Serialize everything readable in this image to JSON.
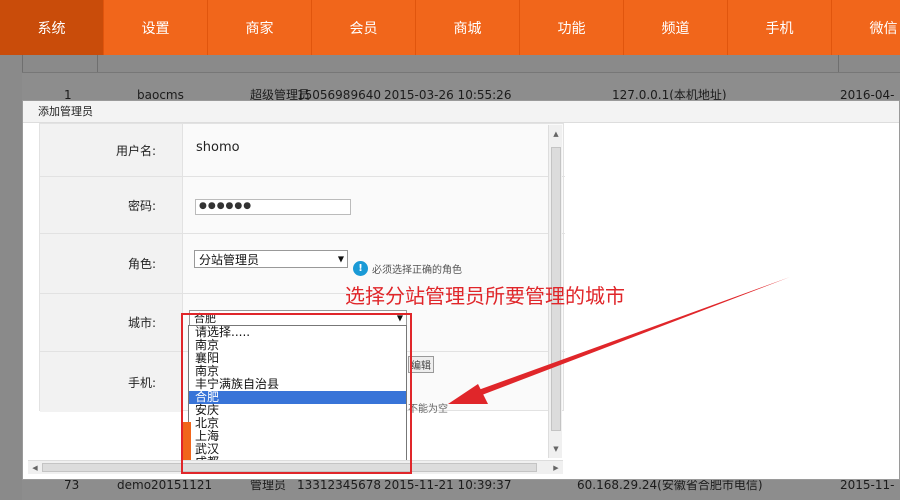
{
  "nav": {
    "items": [
      "系统",
      "设置",
      "商家",
      "会员",
      "商城",
      "功能",
      "频道",
      "手机",
      "微信"
    ],
    "active_index": 0
  },
  "bg_table": {
    "row1": {
      "id": "1",
      "username": "baocms",
      "role": "超级管理员",
      "mobile": "15056989640",
      "time": "2015-03-26 10:55:26",
      "ip": "127.0.0.1(本机地址)",
      "last": "2016-04-"
    },
    "row2": {
      "id": "73",
      "username": "demo20151121",
      "role": "管理员",
      "mobile": "13312345678",
      "time": "2015-11-21 10:39:37",
      "ip": "60.168.29.24(安徽省合肥市电信)",
      "last": "2015-11-"
    }
  },
  "dialog": {
    "title": "添加管理员",
    "close_icon": "close-icon",
    "fields": {
      "username": {
        "label": "用户名:",
        "value": "shomo"
      },
      "password": {
        "label": "密码:",
        "value": "●●●●●●"
      },
      "role": {
        "label": "角色:",
        "selected": "分站管理员",
        "hint": "必须选择正确的角色",
        "hint_icon": "!"
      },
      "city": {
        "label": "城市:",
        "selected": "合肥"
      },
      "mobile": {
        "label": "手机:"
      }
    },
    "partial_text": {
      "edit": "编辑",
      "not_empty": "不能为空"
    }
  },
  "city_options": [
    "请选择.....",
    "南京",
    "襄阳",
    "南京",
    "丰宁满族自治县",
    "合肥",
    "安庆",
    "北京",
    "上海",
    "武汉",
    "成都"
  ],
  "city_selected_index": 5,
  "annotation": {
    "text": "选择分站管理员所要管理的城市",
    "color": "#e0262a"
  },
  "colors": {
    "accent": "#f1661b",
    "selection": "#3874d8",
    "hint_icon": "#1a9ad6"
  }
}
